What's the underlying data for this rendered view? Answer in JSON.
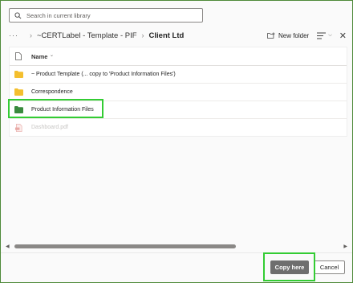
{
  "search": {
    "placeholder": "Search in current library"
  },
  "breadcrumb": {
    "more": "···",
    "items": [
      "~CERTLabel - Template - PIF"
    ],
    "current": "Client Ltd"
  },
  "toolbar": {
    "new_folder_label": "New folder"
  },
  "list": {
    "header": {
      "name_label": "Name"
    },
    "rows": [
      {
        "label": "~ Product Template (... copy to 'Product Information Files')",
        "icon": "folder-icon",
        "color": "#f4bf2e"
      },
      {
        "label": "Correspondence",
        "icon": "folder-icon",
        "color": "#f4bf2e"
      },
      {
        "label": "Product Information Files",
        "icon": "folder-icon",
        "color": "#3a8a3e"
      },
      {
        "label": "Dashboard.pdf",
        "icon": "pdf-file-icon",
        "color": "#e8a9a5"
      }
    ]
  },
  "footer": {
    "copy_label": "Copy here",
    "cancel_label": "Cancel"
  },
  "colors": {
    "highlight": "#33cc33",
    "primary_button": "#6e6e6e"
  }
}
